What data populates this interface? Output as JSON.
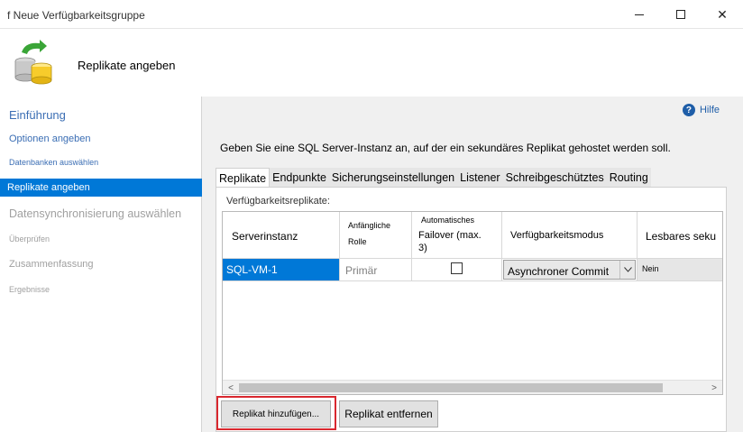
{
  "window": {
    "title": "f Neue Verfügbarkeitsgruppe",
    "minimize": "—",
    "maximize": "☐",
    "close": "✕"
  },
  "header": {
    "title": "Replikate angeben"
  },
  "sidebar": {
    "items": [
      {
        "label": "Einführung",
        "state": "link"
      },
      {
        "label": "Optionen angeben",
        "state": "link"
      },
      {
        "label": "Datenbanken auswählen",
        "state": "link"
      },
      {
        "label": "Replikate angeben",
        "state": "selected"
      },
      {
        "label": "Datensynchronisierung auswählen",
        "state": "disabled"
      },
      {
        "label": "Überprüfen",
        "state": "disabled"
      },
      {
        "label": "Zusammenfassung",
        "state": "disabled"
      },
      {
        "label": "Ergebnisse",
        "state": "disabled"
      }
    ]
  },
  "help": {
    "label": "Hilfe",
    "icon": "?"
  },
  "instruction": "Geben Sie eine SQL Server-Instanz an, auf der ein sekundäres Replikat gehostet werden soll.",
  "tabs": [
    {
      "label": "Replikate",
      "active": true
    },
    {
      "label": "Endpunkte",
      "active": false
    },
    {
      "label": "Sicherungseinstellungen",
      "active": false
    },
    {
      "label": "Listener",
      "active": false
    },
    {
      "label": "Schreibgeschütztes",
      "active": false
    },
    {
      "label": "Routing",
      "active": false
    }
  ],
  "panel": {
    "label": "Verfügbarkeitsreplikate:"
  },
  "grid": {
    "columns": {
      "server": "Serverinstanz",
      "role_line1": "Anfängliche",
      "role_line2": "Rolle",
      "failover_line1": "Automatisches",
      "failover_line2": "Failover (max.",
      "failover_line3": "3)",
      "mode": "Verfügbarkeitsmodus",
      "readable": "Lesbares seku"
    },
    "rows": [
      {
        "server": "SQL-VM-1",
        "role": "Primär",
        "failover": false,
        "mode": "Asynchroner Commit",
        "readable": "Nein"
      }
    ],
    "scroll_left": "<",
    "scroll_right": ">"
  },
  "buttons": {
    "add": "Replikat hinzufügen...",
    "remove": "Replikat entfernen"
  },
  "colors": {
    "selection": "#0078d7",
    "highlight_box": "#d9282f",
    "link": "#1f5ea8"
  }
}
